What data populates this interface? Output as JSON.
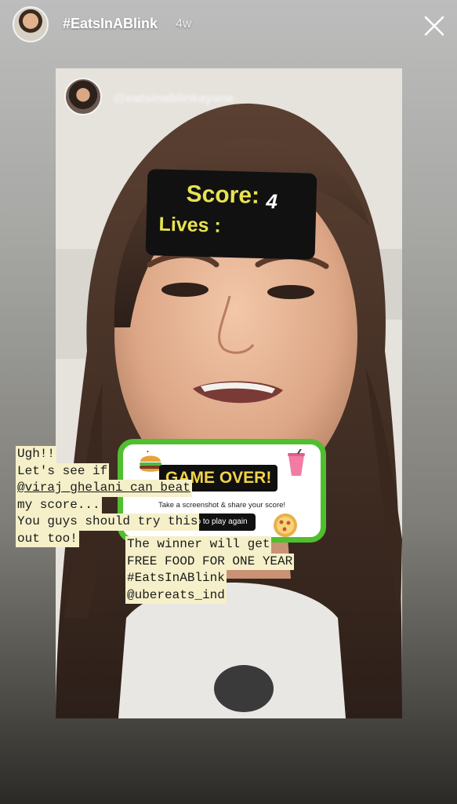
{
  "header": {
    "title": "#EatsInABlink",
    "time_ago": "4w"
  },
  "post": {
    "username": "@eatsinablinkayane"
  },
  "game": {
    "score_label": "Score:",
    "score_value": "4",
    "lives_label": "Lives :",
    "game_over": "GAME OVER!",
    "subtitle": "Take a screenshot & share your score!",
    "play_again": "Tap to play again"
  },
  "caption_left": {
    "line1": "Ugh!!",
    "line2": "Let's see if",
    "line3": "@viraj_ghelani can beat",
    "line4": "my score...",
    "line5": "You guys should try this",
    "line6": "out too!"
  },
  "caption_right": {
    "line1": "The winner will get",
    "line2": "FREE FOOD FOR ONE YEAR",
    "line3": "#EatsInABlink",
    "line4": "@ubereats_ind"
  },
  "colors": {
    "card_border": "#4fbf2f",
    "score_text": "#e8e253",
    "caption_highlight": "#f5f0c9"
  }
}
